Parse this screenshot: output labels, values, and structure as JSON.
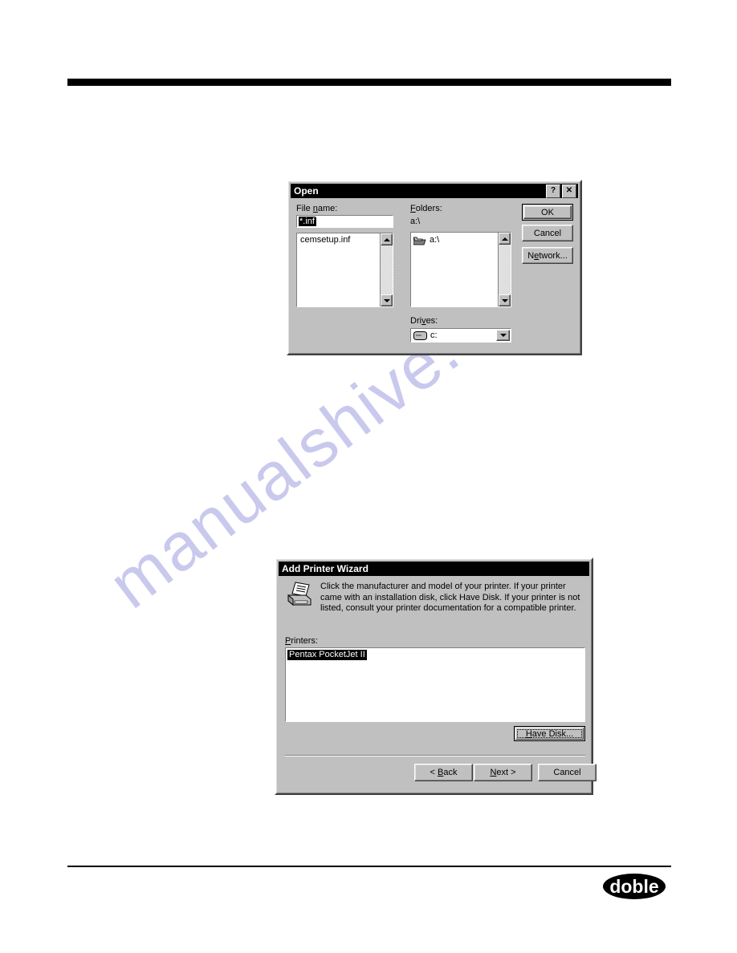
{
  "page": {
    "watermark_text": "manualshive.com",
    "logo_text": "doble"
  },
  "open_dialog": {
    "title": "Open",
    "titlebar_buttons": [
      {
        "name": "help-button",
        "glyph": "?"
      },
      {
        "name": "close-button",
        "glyph": "✕"
      }
    ],
    "file_name_label": "File name:",
    "file_name_label_pre": "File ",
    "file_name_label_accel": "n",
    "file_name_label_post": "ame:",
    "file_name_value": "*.inf",
    "file_list": [
      "cemsetup.inf"
    ],
    "folders_label": "Folders:",
    "folders_label_pre": "",
    "folders_label_accel": "F",
    "folders_label_post": "olders:",
    "current_path": "a:\\",
    "folder_items": [
      {
        "label": "a:\\",
        "icon": "open-folder-icon"
      }
    ],
    "drives_label": "Drives:",
    "drives_label_pre": "Dri",
    "drives_label_accel": "v",
    "drives_label_post": "es:",
    "drives_value": "c:",
    "buttons": [
      {
        "name": "ok-button",
        "label": "OK",
        "default": true
      },
      {
        "name": "cancel-button",
        "label": "Cancel",
        "default": false
      },
      {
        "name": "network-button",
        "label": "Network...",
        "default": false,
        "accel_pre": "N",
        "accel": "e",
        "accel_post": "twork..."
      }
    ]
  },
  "printer_wizard": {
    "title": "Add Printer Wizard",
    "icon": "printer-icon",
    "body_text": "Click the manufacturer and model of your printer. If your printer came with an installation disk, click Have Disk. If your printer is not listed, consult your printer documentation for a compatible printer.",
    "printers_label": "Printers:",
    "printers_label_accel": "P",
    "printers_label_post": "rinters:",
    "printers": [
      "Pentax PocketJet II"
    ],
    "selected_printer": "Pentax PocketJet II",
    "have_disk_label": "Have Disk...",
    "have_disk_accel_pre": "H",
    "have_disk_accel": "a",
    "have_disk_accel_post": "ve Disk...",
    "nav_buttons": [
      {
        "name": "back-button",
        "label": "< Back",
        "pre": "< ",
        "accel": "B",
        "post": "ack"
      },
      {
        "name": "next-button",
        "label": "Next >",
        "pre": "",
        "accel": "N",
        "post": "ext >"
      },
      {
        "name": "cancel-button",
        "label": "Cancel",
        "pre": "Cancel",
        "accel": "",
        "post": ""
      }
    ]
  },
  "colors": {
    "face": "#c0c0c0",
    "titlebar": "#000000",
    "highlight": "#000000",
    "watermark": "#c9c9ee"
  }
}
